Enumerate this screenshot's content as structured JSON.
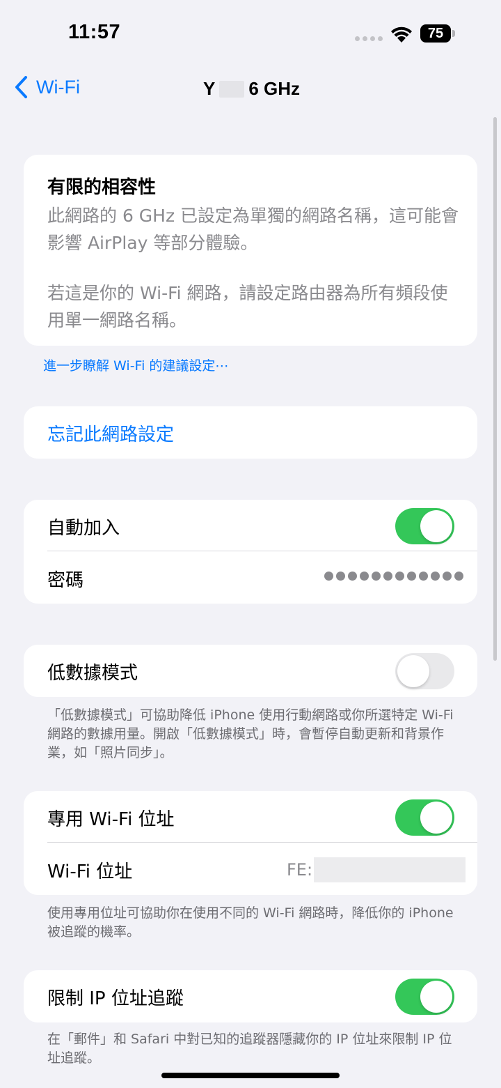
{
  "status_bar": {
    "time": "11:57",
    "battery": "75"
  },
  "nav": {
    "back_label": "Wi-Fi",
    "title_prefix": "Y",
    "title_suffix": "6 GHz"
  },
  "compat": {
    "title": "有限的相容性",
    "paragraph1": "此網路的 6 GHz 已設定為單獨的網路名稱，這可能會影響 AirPlay 等部分體驗。",
    "paragraph2": "若這是你的 Wi-Fi 網路，請設定路由器為所有頻段使用單一網路名稱。",
    "footer_link": "進一步瞭解 Wi-Fi 的建議設定⋯"
  },
  "forget": {
    "label": "忘記此網路設定"
  },
  "join_section": {
    "auto_join_label": "自動加入",
    "auto_join_on": true,
    "password_label": "密碼",
    "password_mask": "●●●●●●●●●●●●"
  },
  "low_data": {
    "label": "低數據模式",
    "on": false,
    "footer": "「低數據模式」可協助降低 iPhone 使用行動網路或你所選特定 Wi-Fi 網路的數據用量。開啟「低數據模式」時，會暫停自動更新和背景作業，如「照片同步」。"
  },
  "private_address": {
    "label": "專用 Wi-Fi 位址",
    "on": true,
    "address_label": "Wi-Fi 位址",
    "address_value": "FE:",
    "footer": "使用專用位址可協助你在使用不同的 Wi-Fi 網路時，降低你的 iPhone 被追蹤的機率。"
  },
  "ip_tracking": {
    "label": "限制 IP 位址追蹤",
    "on": true,
    "footer": "在「郵件」和 Safari 中對已知的追蹤器隱藏你的 IP 位址來限制 IP 位址追蹤。"
  },
  "colors": {
    "accent": "#0a7aff",
    "toggle_on": "#34c759",
    "toggle_off": "#e9e9eb",
    "background": "#f2f2f7"
  }
}
